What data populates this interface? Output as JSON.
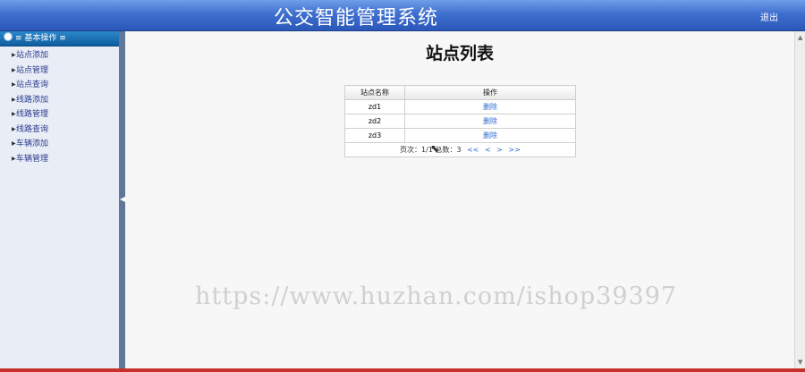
{
  "header": {
    "title": "公交智能管理系统",
    "logout_label": "退出"
  },
  "sidebar": {
    "section_title": "≡ 基本操作 ≡",
    "items": [
      {
        "label": "站点添加"
      },
      {
        "label": "站点管理"
      },
      {
        "label": "站点查询"
      },
      {
        "label": "线路添加"
      },
      {
        "label": "线路管理"
      },
      {
        "label": "线路查询"
      },
      {
        "label": "车辆添加"
      },
      {
        "label": "车辆管理"
      }
    ]
  },
  "main": {
    "title": "站点列表",
    "table": {
      "columns": [
        "站点名称",
        "操作"
      ],
      "rows": [
        {
          "name": "zd1",
          "action": "删除"
        },
        {
          "name": "zd2",
          "action": "删除"
        },
        {
          "name": "zd3",
          "action": "删除"
        }
      ]
    },
    "pager": {
      "page_label": "页次：",
      "page_value": "1/1",
      "total_label": "总数：",
      "total_value": "3",
      "first": "<<",
      "prev": "<",
      "next": ">",
      "last": ">>"
    }
  },
  "watermark": "https://www.huzhan.com/ishop39397",
  "colors": {
    "header_bg": "#3f6fcf",
    "link": "#2d6bd1",
    "bottom_accent": "#c7302b"
  }
}
